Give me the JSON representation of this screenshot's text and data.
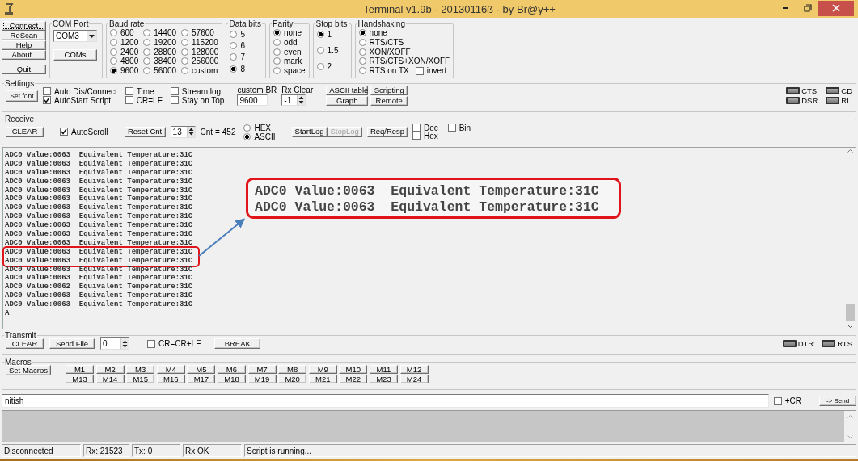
{
  "window": {
    "title": "Terminal v1.9b - 20130116ß - by Br@y++"
  },
  "main_buttons": [
    {
      "label": "Connect",
      "focused": true
    },
    {
      "label": "ReScan",
      "focused": false
    },
    {
      "label": "Help",
      "focused": false
    },
    {
      "label": "About..",
      "focused": false
    },
    {
      "label": "Quit",
      "focused": false
    }
  ],
  "com_port": {
    "title": "COM Port",
    "value": "COM3",
    "button": "COMs"
  },
  "baud_rate": {
    "title": "Baud rate",
    "options": [
      {
        "label": "600",
        "selected": false
      },
      {
        "label": "14400",
        "selected": false
      },
      {
        "label": "57600",
        "selected": false
      },
      {
        "label": "1200",
        "selected": false
      },
      {
        "label": "19200",
        "selected": false
      },
      {
        "label": "115200",
        "selected": false
      },
      {
        "label": "2400",
        "selected": false
      },
      {
        "label": "28800",
        "selected": false
      },
      {
        "label": "128000",
        "selected": false
      },
      {
        "label": "4800",
        "selected": false
      },
      {
        "label": "38400",
        "selected": false
      },
      {
        "label": "256000",
        "selected": false
      },
      {
        "label": "9600",
        "selected": true
      },
      {
        "label": "56000",
        "selected": false
      },
      {
        "label": "custom",
        "selected": false
      }
    ]
  },
  "data_bits": {
    "title": "Data bits",
    "options": [
      {
        "label": "5",
        "selected": false
      },
      {
        "label": "6",
        "selected": false
      },
      {
        "label": "7",
        "selected": false
      },
      {
        "label": "8",
        "selected": true
      }
    ]
  },
  "parity": {
    "title": "Parity",
    "options": [
      {
        "label": "none",
        "selected": true
      },
      {
        "label": "odd",
        "selected": false
      },
      {
        "label": "even",
        "selected": false
      },
      {
        "label": "mark",
        "selected": false
      },
      {
        "label": "space",
        "selected": false
      }
    ]
  },
  "stop_bits": {
    "title": "Stop bits",
    "options": [
      {
        "label": "1",
        "selected": true
      },
      {
        "label": "1.5",
        "selected": false
      },
      {
        "label": "2",
        "selected": false
      }
    ]
  },
  "handshaking": {
    "title": "Handshaking",
    "options": [
      {
        "label": "none",
        "selected": true
      },
      {
        "label": "RTS/CTS",
        "selected": false
      },
      {
        "label": "XON/XOFF",
        "selected": false
      },
      {
        "label": "RTS/CTS+XON/XOFF",
        "selected": false
      },
      {
        "label": "RTS on TX",
        "selected": false
      }
    ],
    "invert": {
      "label": "invert",
      "checked": false
    }
  },
  "settings": {
    "title": "Settings",
    "set_font": "Set font",
    "checkboxes": [
      {
        "label": "Auto Dis/Connect",
        "checked": false
      },
      {
        "label": "AutoStart Script",
        "checked": true
      },
      {
        "label": "Time",
        "checked": false
      },
      {
        "label": "CR=LF",
        "checked": false
      },
      {
        "label": "Stream log",
        "checked": false
      },
      {
        "label": "Stay on Top",
        "checked": false
      }
    ],
    "custom_br": {
      "label": "custom BR",
      "value": "9600"
    },
    "rx_clear": {
      "label": "Rx Clear",
      "value": "-1"
    },
    "buttons": [
      "ASCII table",
      "Graph",
      "Scripting",
      "Remote"
    ],
    "indicators": [
      "CTS",
      "CD",
      "DSR",
      "RI"
    ]
  },
  "receive": {
    "title": "Receive",
    "clear": "CLEAR",
    "autoscroll": {
      "label": "AutoScroll",
      "checked": true
    },
    "reset_cnt": "Reset Cnt",
    "spin_value": "13",
    "cnt_label": "Cnt =",
    "count": "452",
    "format": [
      {
        "label": "HEX",
        "selected": false
      },
      {
        "label": "ASCII",
        "selected": true
      }
    ],
    "log_buttons": [
      {
        "label": "StartLog",
        "disabled": false
      },
      {
        "label": "StopLog",
        "disabled": true
      }
    ],
    "req_resp": "Req/Resp",
    "display": [
      {
        "label": "Dec",
        "checked": false
      },
      {
        "label": "Hex",
        "checked": false
      },
      {
        "label": "Bin",
        "checked": false
      }
    ],
    "lines": [
      {
        "text": "ADC0 Value:0063  Equivalent Temperature:31C",
        "highlighted": false
      },
      {
        "text": "ADC0 Value:0063  Equivalent Temperature:31C",
        "highlighted": false
      },
      {
        "text": "ADC0 Value:0063  Equivalent Temperature:31C",
        "highlighted": false
      },
      {
        "text": "ADC0 Value:0063  Equivalent Temperature:31C",
        "highlighted": false
      },
      {
        "text": "ADC0 Value:0063  Equivalent Temperature:31C",
        "highlighted": false
      },
      {
        "text": "ADC0 Value:0063  Equivalent Temperature:31C",
        "highlighted": false
      },
      {
        "text": "ADC0 Value:0063  Equivalent Temperature:31C",
        "highlighted": false
      },
      {
        "text": "ADC0 Value:0063  Equivalent Temperature:31C",
        "highlighted": false
      },
      {
        "text": "ADC0 Value:0063  Equivalent Temperature:31C",
        "highlighted": false
      },
      {
        "text": "ADC0 Value:0063  Equivalent Temperature:31C",
        "highlighted": false
      },
      {
        "text": "ADC0 Value:0063  Equivalent Temperature:31C",
        "highlighted": false
      },
      {
        "text": "ADC0 Value:0063  Equivalent Temperature:31C",
        "highlighted": true
      },
      {
        "text": "ADC0 Value:0063  Equivalent Temperature:31C",
        "highlighted": true
      },
      {
        "text": "ADC0 Value:0063  Equivalent Temperature:31C",
        "highlighted": false
      },
      {
        "text": "ADC0 Value:0063  Equivalent Temperature:31C",
        "highlighted": false
      },
      {
        "text": "ADC0 Value:0062  Equivalent Temperature:31C",
        "highlighted": false
      },
      {
        "text": "ADC0 Value:0063  Equivalent Temperature:31C",
        "highlighted": false
      },
      {
        "text": "ADC0 Value:0063  Equivalent Temperature:31C",
        "highlighted": false
      },
      {
        "text": "A",
        "highlighted": false
      }
    ]
  },
  "callout": {
    "lines": [
      "ADC0 Value:0063  Equivalent Temperature:31C",
      "ADC0 Value:0063  Equivalent Temperature:31C"
    ]
  },
  "transmit": {
    "title": "Transmit",
    "clear": "CLEAR",
    "send_file": "Send File",
    "spin_value": "0",
    "crlf": {
      "label": "CR=CR+LF",
      "checked": false
    },
    "break": "BREAK",
    "indicators": [
      "DTR",
      "RTS"
    ]
  },
  "macros": {
    "title": "Macros",
    "set_macros": "Set Macros",
    "keys": [
      "M1",
      "M2",
      "M3",
      "M4",
      "M5",
      "M6",
      "M7",
      "M8",
      "M9",
      "M10",
      "M11",
      "M12",
      "M13",
      "M14",
      "M15",
      "M16",
      "M17",
      "M18",
      "M19",
      "M20",
      "M21",
      "M22",
      "M23",
      "M24"
    ]
  },
  "input": {
    "value": "nitish",
    "plus_cr": {
      "label": "+CR",
      "checked": false
    },
    "send": "-> Send"
  },
  "status_bar": [
    "Disconnected",
    "Rx: 21523",
    "Tx: 0",
    "Rx OK",
    "Script is running..."
  ]
}
